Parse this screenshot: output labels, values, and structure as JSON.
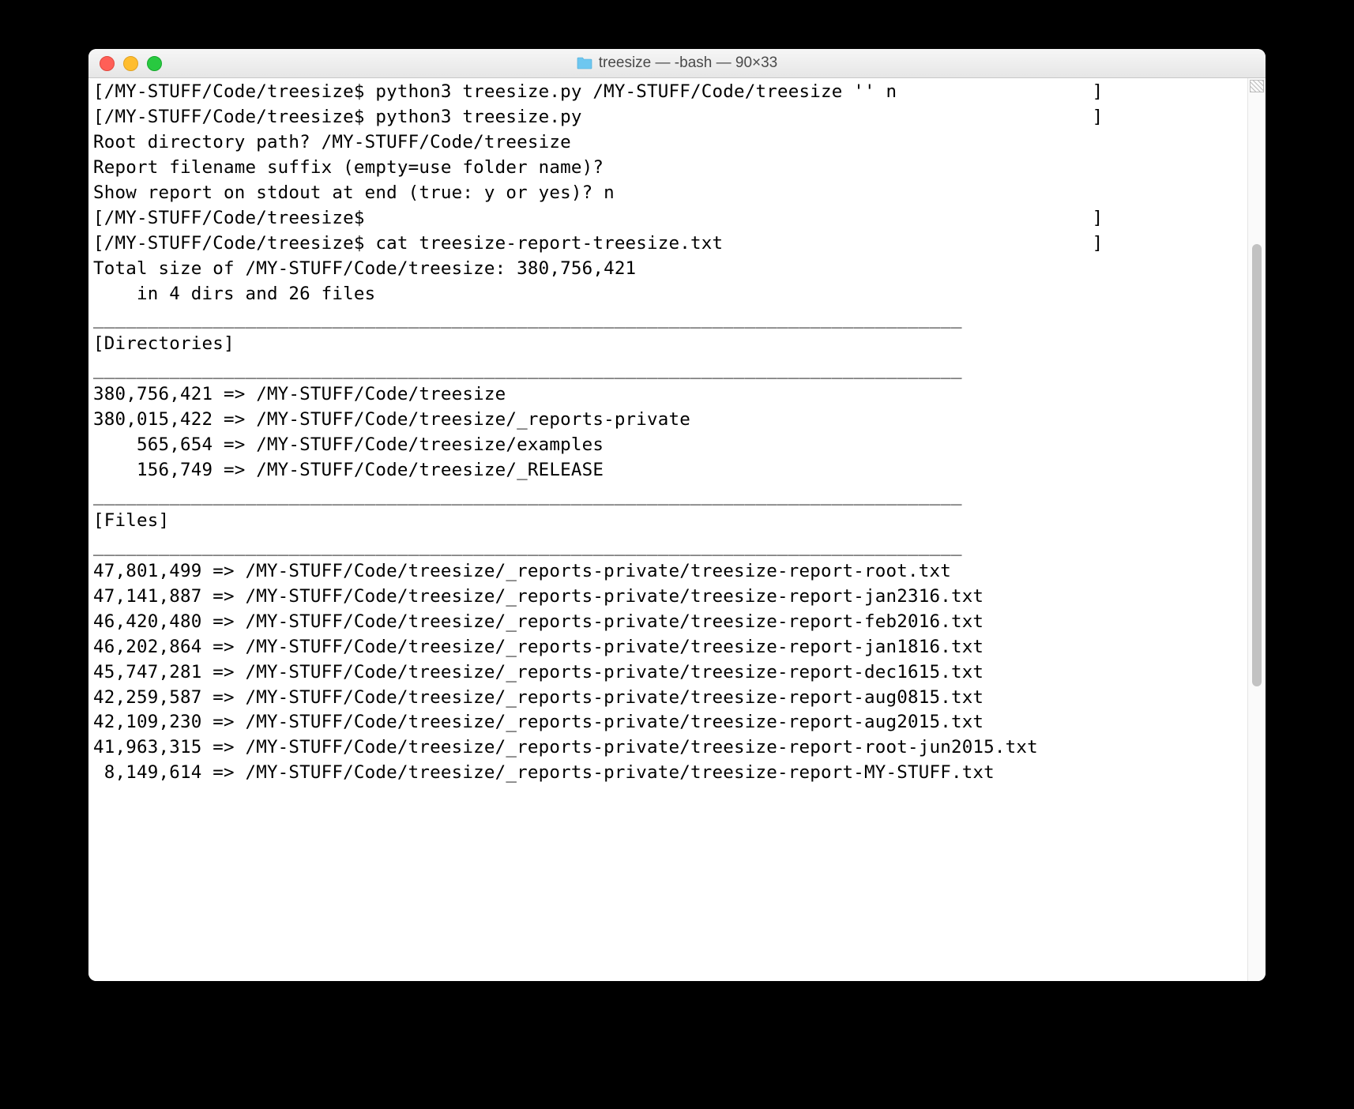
{
  "window": {
    "title": "treesize — -bash — 90×33"
  },
  "terminal": {
    "lines": [
      "[/MY-STUFF/Code/treesize$ python3 treesize.py /MY-STUFF/Code/treesize '' n                  ]",
      "[/MY-STUFF/Code/treesize$ python3 treesize.py                                               ]",
      "Root directory path? /MY-STUFF/Code/treesize",
      "Report filename suffix (empty=use folder name)? ",
      "Show report on stdout at end (true: y or yes)? n",
      "[/MY-STUFF/Code/treesize$                                                                   ]",
      "[/MY-STUFF/Code/treesize$ cat treesize-report-treesize.txt                                  ]",
      "",
      "Total size of /MY-STUFF/Code/treesize: 380,756,421",
      "    in 4 dirs and 26 files",
      "",
      "________________________________________________________________________________",
      "[Directories]",
      "________________________________________________________________________________",
      "",
      "380,756,421 => /MY-STUFF/Code/treesize",
      "380,015,422 => /MY-STUFF/Code/treesize/_reports-private",
      "    565,654 => /MY-STUFF/Code/treesize/examples",
      "    156,749 => /MY-STUFF/Code/treesize/_RELEASE",
      "",
      "________________________________________________________________________________",
      "[Files]",
      "________________________________________________________________________________",
      "",
      "47,801,499 => /MY-STUFF/Code/treesize/_reports-private/treesize-report-root.txt",
      "47,141,887 => /MY-STUFF/Code/treesize/_reports-private/treesize-report-jan2316.txt",
      "46,420,480 => /MY-STUFF/Code/treesize/_reports-private/treesize-report-feb2016.txt",
      "46,202,864 => /MY-STUFF/Code/treesize/_reports-private/treesize-report-jan1816.txt",
      "45,747,281 => /MY-STUFF/Code/treesize/_reports-private/treesize-report-dec1615.txt",
      "42,259,587 => /MY-STUFF/Code/treesize/_reports-private/treesize-report-aug0815.txt",
      "42,109,230 => /MY-STUFF/Code/treesize/_reports-private/treesize-report-aug2015.txt",
      "41,963,315 => /MY-STUFF/Code/treesize/_reports-private/treesize-report-root-jun2015.txt",
      " 8,149,614 => /MY-STUFF/Code/treesize/_reports-private/treesize-report-MY-STUFF.txt"
    ]
  }
}
